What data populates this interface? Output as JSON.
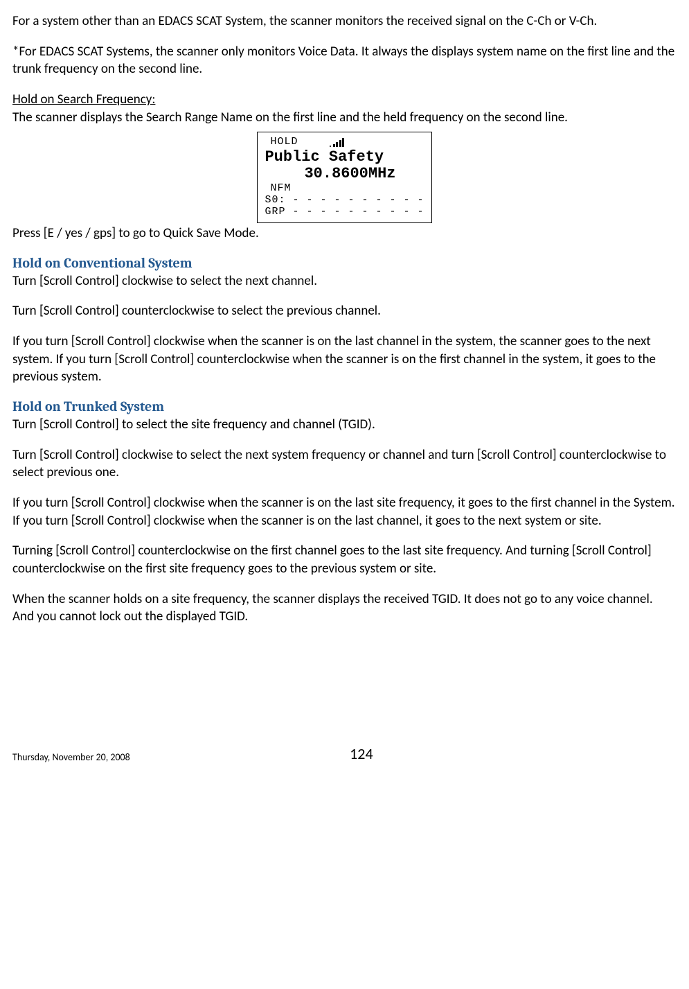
{
  "para_edacs_other": "For a system other than an EDACS SCAT System, the scanner monitors the received signal on the C-Ch or V-Ch.",
  "para_edacs_scat": "*For EDACS SCAT Systems, the scanner only monitors Voice Data. It always the displays system name on the first line and the trunk frequency on the second line.",
  "hold_search_label": "Hold on Search Frequency:",
  "hold_search_desc": "The scanner displays the Search Range Name on the first line and the held frequency on the second line.",
  "display": {
    "hold_label": "HOLD",
    "line_name": "Public Safety",
    "line_freq": "30.8600MHz",
    "mode": "NFM",
    "s0": "S0: - - - - - - - - - -",
    "grp": "GRP - - - - - - - - - -"
  },
  "press_e": "Press [E / yes / gps] to go to Quick Save Mode.",
  "h_conv": "Hold on Conventional System",
  "conv_p1": "Turn [Scroll Control] clockwise to select the next channel.",
  "conv_p2": "Turn [Scroll Control] counterclockwise to select the previous channel.",
  "conv_p3": "If you turn [Scroll Control] clockwise when the scanner is on the last channel in the system, the scanner goes to the next system. If you turn [Scroll Control] counterclockwise when the scanner is on the first channel in the system, it goes to the previous system.",
  "h_trunk": "Hold on Trunked System",
  "trunk_p1": "Turn [Scroll Control] to select the site frequency and channel (TGID).",
  "trunk_p2": "Turn [Scroll Control] clockwise to select the next system frequency or channel and turn [Scroll Control] counterclockwise to select previous one.",
  "trunk_p3": "If you turn [Scroll Control] clockwise when the scanner is on the last site frequency, it goes to the first channel in the System. If you turn [Scroll Control] clockwise when the scanner is on the last channel, it goes to the next system or site.",
  "trunk_p4": "Turning [Scroll Control] counterclockwise on the first channel goes to the last site frequency. And turning [Scroll Control] counterclockwise on the first site frequency goes to the previous system or site.",
  "trunk_p5": "When the scanner holds on a site frequency, the scanner displays the received TGID. It does not go to any voice channel. And you cannot lock out the displayed TGID.",
  "footer": {
    "date": "Thursday, November 20, 2008",
    "page": "124"
  }
}
